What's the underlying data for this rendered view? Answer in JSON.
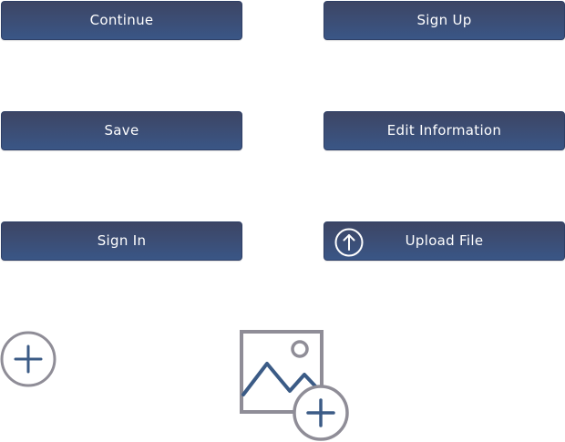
{
  "buttons": {
    "continue": "Continue",
    "sign_up": "Sign Up",
    "save": "Save",
    "edit_information": "Edit Information",
    "sign_in": "Sign In",
    "upload_file": "Upload File"
  },
  "icons": {
    "upload": "upload-arrow-circle-icon",
    "add": "plus-circle-icon",
    "add_image": "add-image-icon"
  },
  "colors": {
    "button_top": "#3d4564",
    "button_bottom": "#3a5686",
    "icon_gray": "#8f8d97",
    "icon_blue": "#3b5b86"
  }
}
